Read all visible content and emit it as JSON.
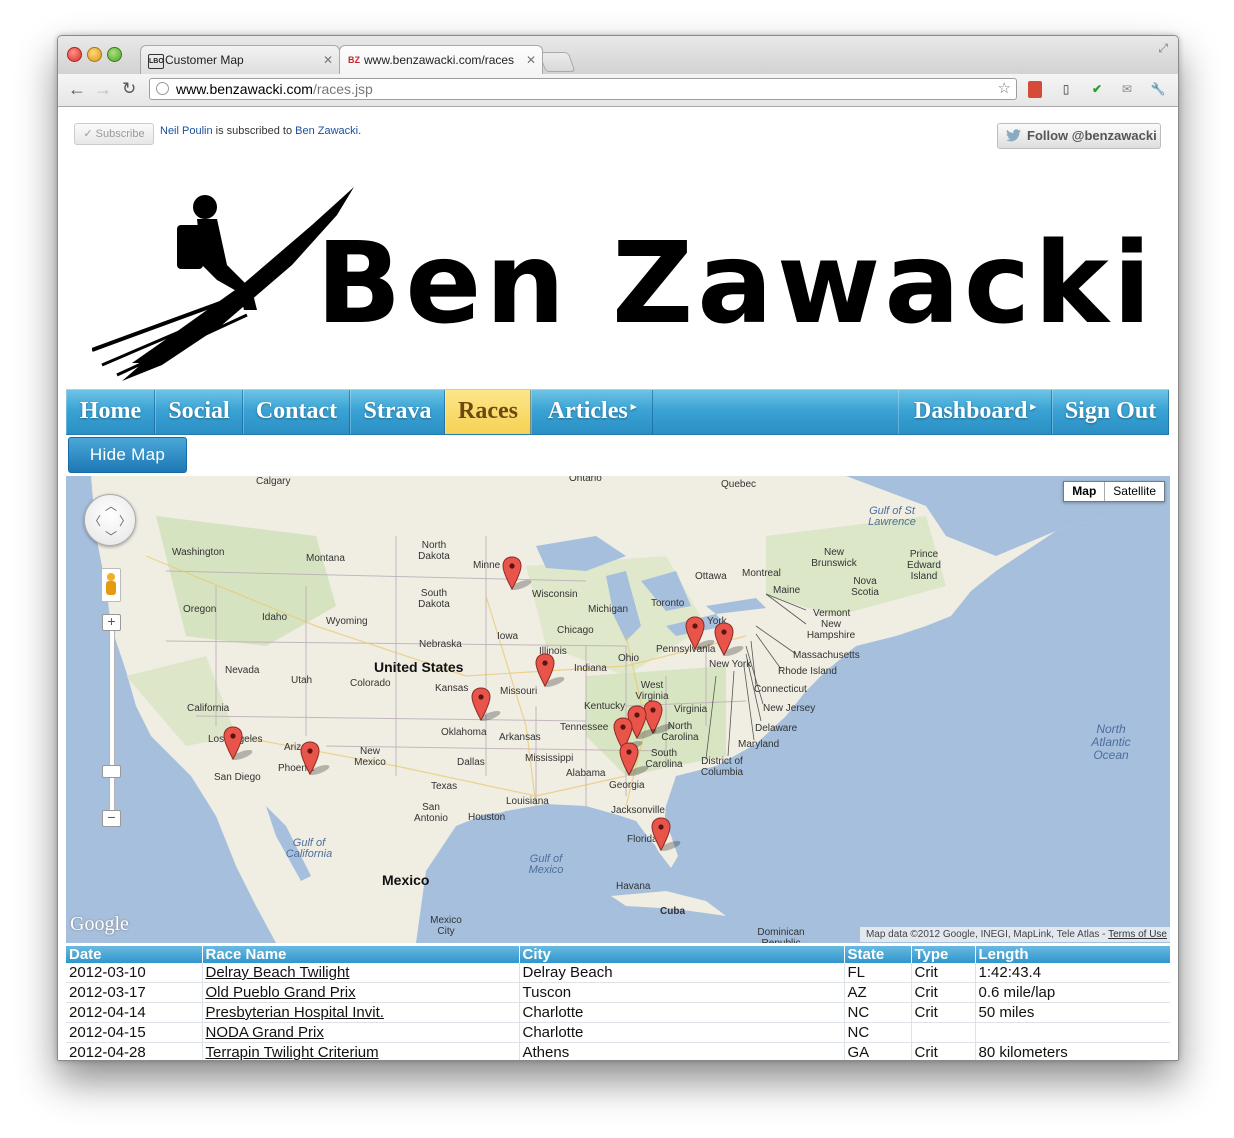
{
  "browser": {
    "tabs": [
      {
        "label": "Customer Map",
        "favicon": "LBO"
      },
      {
        "label": "www.benzawacki.com/races",
        "favicon": "BZ"
      }
    ],
    "url_host": "www.benzawacki.com",
    "url_path": "/races.jsp"
  },
  "header": {
    "subscribe_label": "✓ Subscribe",
    "subscriber_name": "Neil Poulin",
    "subscribe_middle": " is subscribed to ",
    "subscribed_to": "Ben Zawacki",
    "subscribe_end": ".",
    "follow_label": "Follow @benzawacki",
    "logo_text": "Ben Zawacki"
  },
  "nav": {
    "items": [
      {
        "label": "Home"
      },
      {
        "label": "Social"
      },
      {
        "label": "Contact"
      },
      {
        "label": "Strava"
      },
      {
        "label": "Races",
        "active": true
      },
      {
        "label": "Articles",
        "submenu": true
      },
      {
        "label": "Dashboard",
        "submenu": true
      },
      {
        "label": "Sign Out"
      }
    ]
  },
  "map": {
    "toggle_label": "Hide Map",
    "type_options": [
      "Map",
      "Satellite"
    ],
    "selected_type": "Map",
    "attribution": "Map data ©2012 Google, INEGI, MapLink, Tele Atlas - ",
    "terms_label": "Terms of Use",
    "provider": "Google",
    "labels": [
      {
        "text": "Calgary"
      },
      {
        "text": "Ontario"
      },
      {
        "text": "Quebec"
      },
      {
        "text": "Washington"
      },
      {
        "text": "Montana"
      },
      {
        "text": "North Dakota"
      },
      {
        "text": "Oregon"
      },
      {
        "text": "Idaho"
      },
      {
        "text": "Wyoming"
      },
      {
        "text": "South Dakota"
      },
      {
        "text": "Minne"
      },
      {
        "text": "Wisconsin"
      },
      {
        "text": "Michigan"
      },
      {
        "text": "Ottawa"
      },
      {
        "text": "Montreal"
      },
      {
        "text": "New Brunswick"
      },
      {
        "text": "Prince Edward Island"
      },
      {
        "text": "Nova Scotia"
      },
      {
        "text": "Maine"
      },
      {
        "text": "Toronto"
      },
      {
        "text": "Vermont"
      },
      {
        "text": "New Hampshire"
      },
      {
        "text": "Massachusetts"
      },
      {
        "text": "Rhode Island"
      },
      {
        "text": "Connecticut"
      },
      {
        "text": "New Jersey"
      },
      {
        "text": "Delaware"
      },
      {
        "text": "Maryland"
      },
      {
        "text": "District of Columbia"
      },
      {
        "text": "Nevada"
      },
      {
        "text": "Utah"
      },
      {
        "text": "Colorado"
      },
      {
        "text": "Nebraska"
      },
      {
        "text": "Iowa"
      },
      {
        "text": "Chicago"
      },
      {
        "text": "Illinois"
      },
      {
        "text": "Indiana"
      },
      {
        "text": "Ohio"
      },
      {
        "text": "Pennsylvania"
      },
      {
        "text": "York"
      },
      {
        "text": "New York"
      },
      {
        "text": "California"
      },
      {
        "text": "Kansas"
      },
      {
        "text": "Missouri"
      },
      {
        "text": "Kentucky"
      },
      {
        "text": "West Virginia"
      },
      {
        "text": "Virginia"
      },
      {
        "text": "Tennessee"
      },
      {
        "text": "North Carolina"
      },
      {
        "text": "South Carolina"
      },
      {
        "text": "Oklahoma"
      },
      {
        "text": "Arkansas"
      },
      {
        "text": "Mississippi"
      },
      {
        "text": "Alabama"
      },
      {
        "text": "Georgia"
      },
      {
        "text": "Arizona"
      },
      {
        "text": "Phoenix"
      },
      {
        "text": "New Mexico"
      },
      {
        "text": "Los Angeles"
      },
      {
        "text": "San Diego"
      },
      {
        "text": "Dallas"
      },
      {
        "text": "Texas"
      },
      {
        "text": "San Antonio"
      },
      {
        "text": "Houston"
      },
      {
        "text": "Louisiana"
      },
      {
        "text": "Jacksonville"
      },
      {
        "text": "Florida"
      },
      {
        "text": "Havana"
      },
      {
        "text": "Cuba"
      },
      {
        "text": "Mexico City"
      },
      {
        "text": "Dominican Republic"
      }
    ],
    "country_labels": [
      "United States",
      "Mexico"
    ],
    "water_labels": [
      "Gulf of St Lawrence",
      "North Atlantic Ocean",
      "Gulf of California",
      "Gulf of Mexico"
    ],
    "marker_count": 14
  },
  "table": {
    "columns": [
      "Date",
      "Race Name",
      "City",
      "State",
      "Type",
      "Length"
    ],
    "rows": [
      [
        "2012-03-10",
        "Delray Beach Twilight",
        "Delray Beach",
        "FL",
        "Crit",
        "1:42:43.4"
      ],
      [
        "2012-03-17",
        "Old Pueblo Grand Prix",
        "Tuscon",
        "AZ",
        "Crit",
        "0.6 mile/lap"
      ],
      [
        "2012-04-14",
        "Presbyterian Hospital Invit.",
        "Charlotte",
        "NC",
        "Crit",
        "50 miles"
      ],
      [
        "2012-04-15",
        "NODA Grand Prix",
        "Charlotte",
        "NC",
        "",
        ""
      ],
      [
        "2012-04-28",
        "Terrapin Twilight Criterium",
        "Athens",
        "GA",
        "Crit",
        "80 kilometers"
      ]
    ]
  },
  "colors": {
    "nav_blue": "#3aa3d4",
    "nav_active": "#f6d154",
    "marker_red": "#e8544a",
    "water": "#a5bfdd",
    "land": "#f2efe4"
  }
}
